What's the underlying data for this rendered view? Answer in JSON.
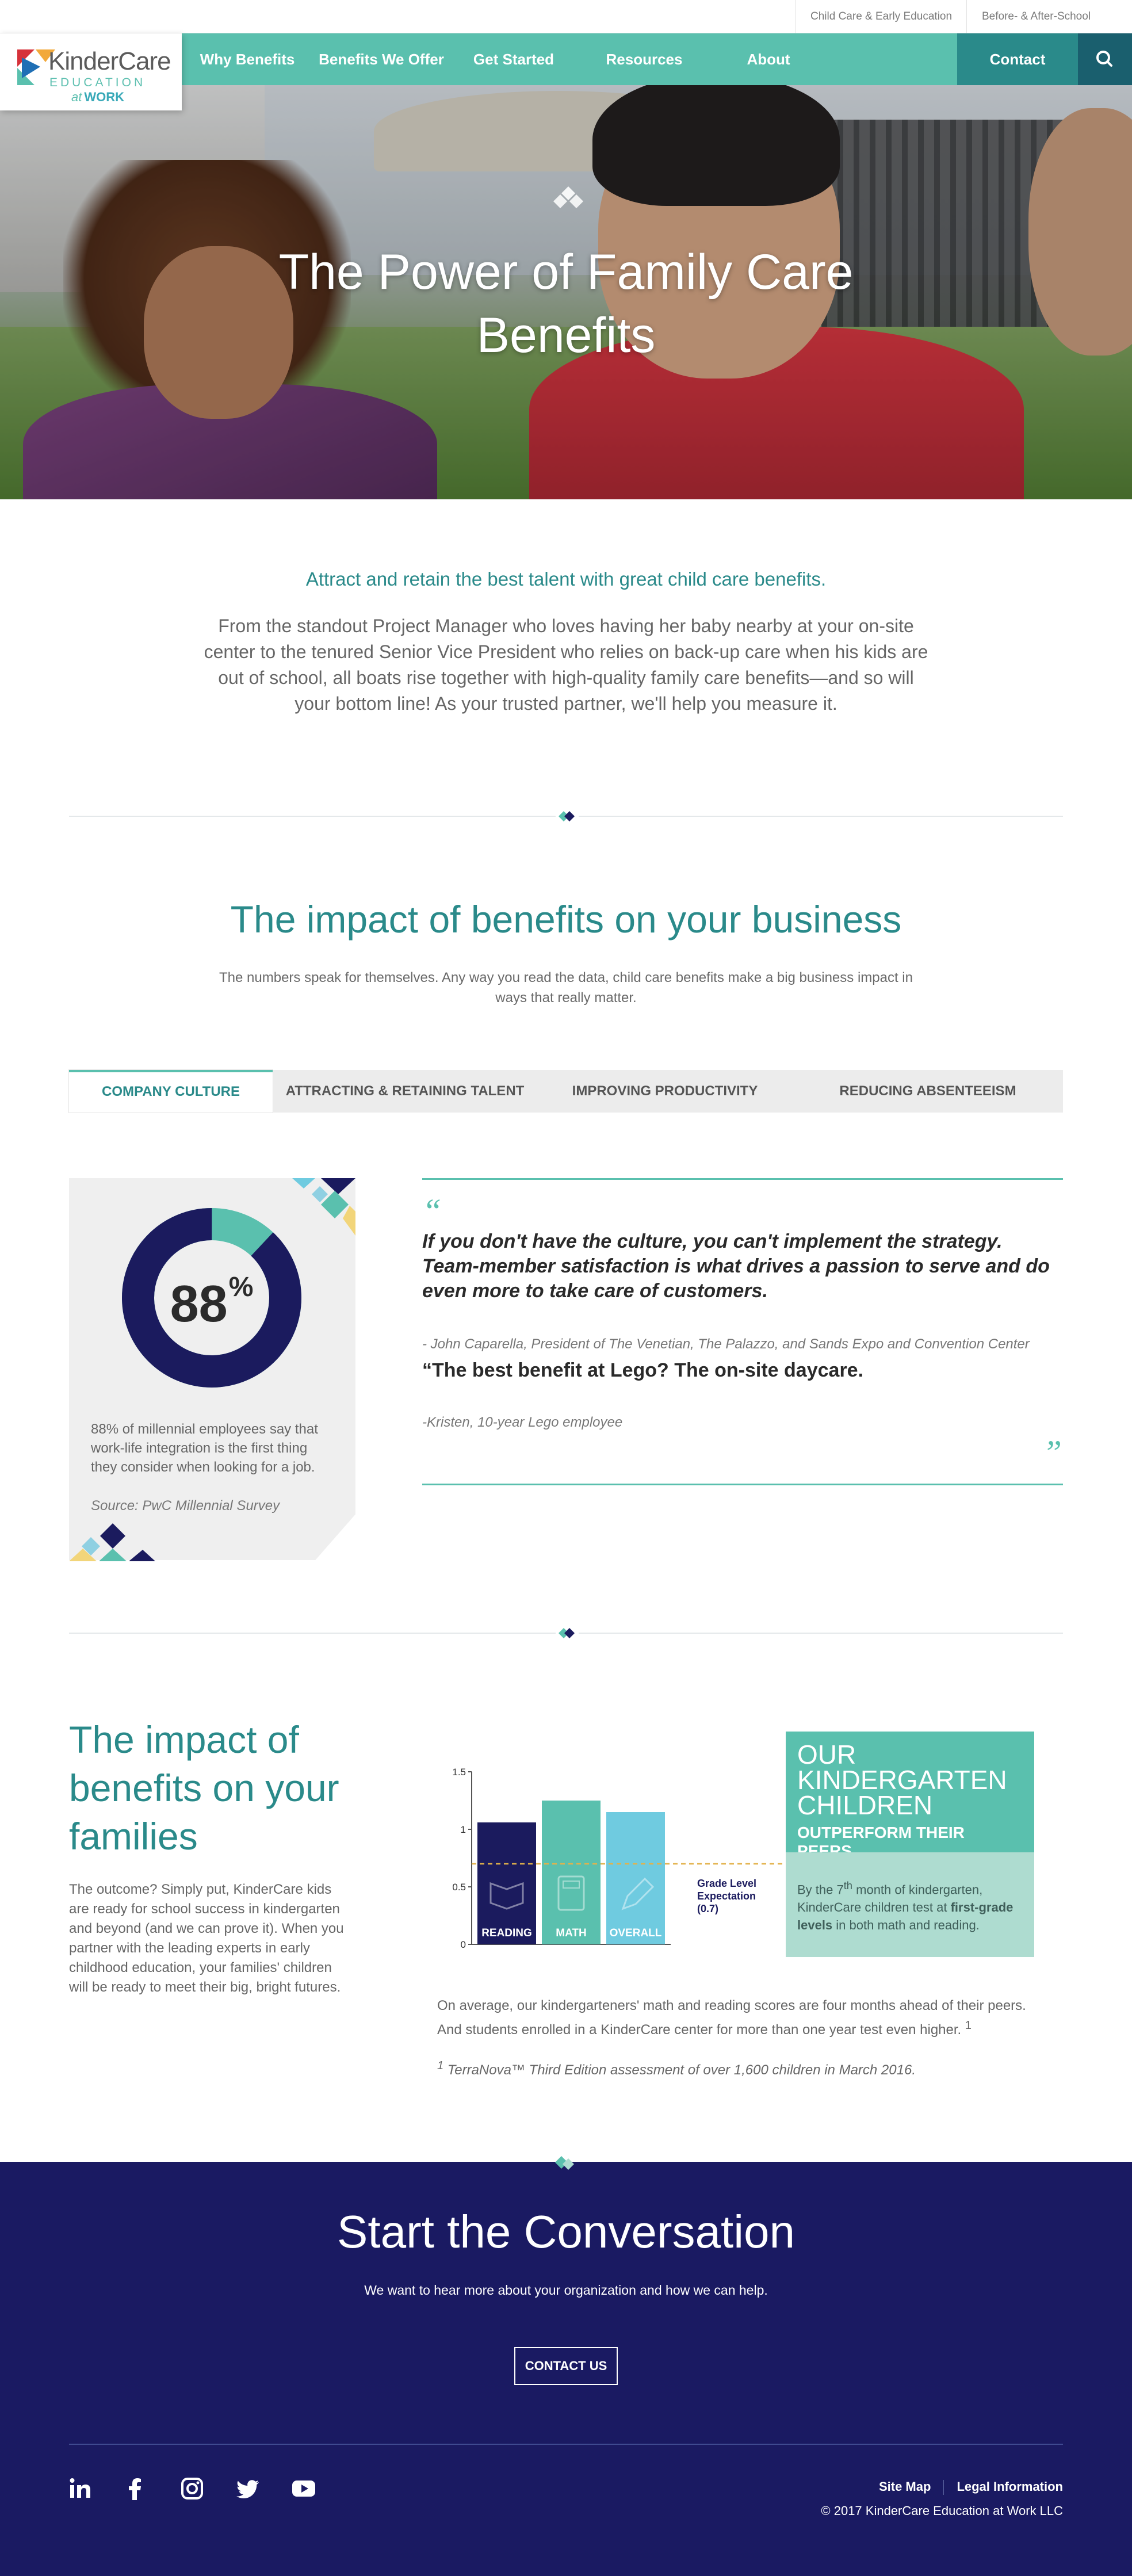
{
  "utility": {
    "link1": "Child Care & Early Education",
    "link2": "Before- & After-School Care"
  },
  "logo": {
    "brand": "KinderCare",
    "sub1": "EDUCATION",
    "sub2_prefix": "at",
    "sub2": "WORK"
  },
  "nav": {
    "items": [
      {
        "label": "Why Benefits Matter"
      },
      {
        "label": "Benefits We Offer"
      },
      {
        "label": "Get Started"
      },
      {
        "label": "Resources"
      },
      {
        "label": "About"
      },
      {
        "label": "Contact"
      }
    ]
  },
  "hero": {
    "title_line1": "The Power of Family Care",
    "title_line2": "Benefits"
  },
  "intro": {
    "lead": "Attract and retain the best talent with great child care benefits.",
    "body": "From the standout Project Manager who loves having her baby nearby at your on-site center to the tenured Senior Vice President who relies on back-up care when his kids are out of school, all boats rise together with high-quality family care benefits—and so will your bottom line! As your trusted partner, we'll help you measure it."
  },
  "business": {
    "title": "The impact of benefits on your business",
    "lead": "The numbers speak for themselves. Any way you read the data, child care benefits make a big business impact in ways that really matter.",
    "tabs": [
      {
        "label": "COMPANY CULTURE"
      },
      {
        "label": "ATTRACTING & RETAINING TALENT"
      },
      {
        "label": "IMPROVING PRODUCTIVITY"
      },
      {
        "label": "REDUCING ABSENTEEISM"
      }
    ],
    "stat": {
      "value": 88,
      "value_label": "88",
      "unit": "%",
      "description": "88% of millennial employees say that work-life integration is the first thing they consider when looking for a job.",
      "source": "Source: PwC Millennial Survey"
    },
    "quotes": {
      "open_mark": "“",
      "close_mark": "”",
      "q1": "If you don't have the culture, you can't implement the strategy. Team-member satisfaction is what drives a passion to serve and do even more to take care of customers.",
      "a1": "- John Caparella, President of The Venetian, The Palazzo, and Sands Expo and Convention Center",
      "q2": "“The best benefit at Lego? The on-site daycare.",
      "a2": "-Kristen, 10-year Lego employee"
    }
  },
  "families": {
    "title": "The impact of benefits on your families",
    "body": "The outcome? Simply put, KinderCare kids are ready for school success in kindergarten and beyond (and we can prove it). When you partner with the leading experts in early childhood education, your families' children will be ready to meet their big, bright futures.",
    "panel": {
      "big": "OUR KINDERGARTEN CHILDREN",
      "small": "OUTPERFORM THEIR PEERS",
      "body_pre": "By the 7",
      "body_sup": "th",
      "body_mid": " month of kindergarten, KinderCare children test at ",
      "body_bold": "first-grade levels",
      "body_post": " in both math and reading."
    },
    "avg_text": "On average, our kindergarteners' math and reading scores are four months ahead of their peers. And students enrolled in a KinderCare center for more than one year test even higher.",
    "avg_sup": "1",
    "footnote_sup": "1",
    "footnote": "TerraNova™ Third Edition assessment of over 1,600 children in March 2016."
  },
  "chart_data": {
    "type": "bar",
    "categories": [
      "READING",
      "MATH",
      "OVERALL"
    ],
    "values": [
      1.06,
      1.25,
      1.15
    ],
    "ylim": [
      0,
      1.5
    ],
    "yticks": [
      "0",
      "0.5",
      "1",
      "1.5"
    ],
    "ytick_values": [
      0,
      0.5,
      1,
      1.5
    ],
    "colors": [
      "#1b1b5e",
      "#5ac0ae",
      "#6fcbe0"
    ],
    "reference_line": {
      "value": 0.7,
      "label_line1": "Grade Level",
      "label_line2": "Expectation",
      "label_line3": "(0.7)"
    }
  },
  "cta": {
    "title": "Start the Conversation",
    "lead": "We want to hear more about your organization and how we can help.",
    "button": "CONTACT US"
  },
  "footer": {
    "social": [
      "linkedin-icon",
      "facebook-icon",
      "instagram-icon",
      "twitter-icon",
      "youtube-icon"
    ],
    "link1": "Site Map",
    "link2": "Legal Information",
    "copyright": "© 2017 KinderCare Education at Work LLC"
  },
  "colors": {
    "teal": "#5ac0ae",
    "dark_teal": "#2a8a8a",
    "navy": "#1a1a62",
    "sky": "#6fcbe0",
    "yellow": "#f2d57a"
  }
}
